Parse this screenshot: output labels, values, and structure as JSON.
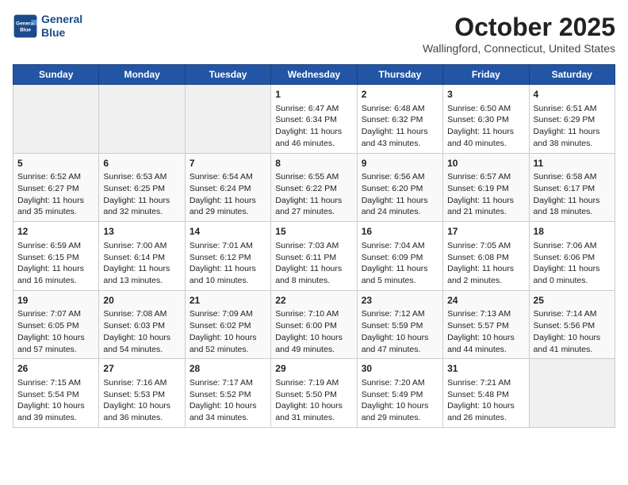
{
  "header": {
    "logo_line1": "General",
    "logo_line2": "Blue",
    "month": "October 2025",
    "location": "Wallingford, Connecticut, United States"
  },
  "weekdays": [
    "Sunday",
    "Monday",
    "Tuesday",
    "Wednesday",
    "Thursday",
    "Friday",
    "Saturday"
  ],
  "weeks": [
    [
      {
        "day": "",
        "info": ""
      },
      {
        "day": "",
        "info": ""
      },
      {
        "day": "",
        "info": ""
      },
      {
        "day": "1",
        "info": "Sunrise: 6:47 AM\nSunset: 6:34 PM\nDaylight: 11 hours\nand 46 minutes."
      },
      {
        "day": "2",
        "info": "Sunrise: 6:48 AM\nSunset: 6:32 PM\nDaylight: 11 hours\nand 43 minutes."
      },
      {
        "day": "3",
        "info": "Sunrise: 6:50 AM\nSunset: 6:30 PM\nDaylight: 11 hours\nand 40 minutes."
      },
      {
        "day": "4",
        "info": "Sunrise: 6:51 AM\nSunset: 6:29 PM\nDaylight: 11 hours\nand 38 minutes."
      }
    ],
    [
      {
        "day": "5",
        "info": "Sunrise: 6:52 AM\nSunset: 6:27 PM\nDaylight: 11 hours\nand 35 minutes."
      },
      {
        "day": "6",
        "info": "Sunrise: 6:53 AM\nSunset: 6:25 PM\nDaylight: 11 hours\nand 32 minutes."
      },
      {
        "day": "7",
        "info": "Sunrise: 6:54 AM\nSunset: 6:24 PM\nDaylight: 11 hours\nand 29 minutes."
      },
      {
        "day": "8",
        "info": "Sunrise: 6:55 AM\nSunset: 6:22 PM\nDaylight: 11 hours\nand 27 minutes."
      },
      {
        "day": "9",
        "info": "Sunrise: 6:56 AM\nSunset: 6:20 PM\nDaylight: 11 hours\nand 24 minutes."
      },
      {
        "day": "10",
        "info": "Sunrise: 6:57 AM\nSunset: 6:19 PM\nDaylight: 11 hours\nand 21 minutes."
      },
      {
        "day": "11",
        "info": "Sunrise: 6:58 AM\nSunset: 6:17 PM\nDaylight: 11 hours\nand 18 minutes."
      }
    ],
    [
      {
        "day": "12",
        "info": "Sunrise: 6:59 AM\nSunset: 6:15 PM\nDaylight: 11 hours\nand 16 minutes."
      },
      {
        "day": "13",
        "info": "Sunrise: 7:00 AM\nSunset: 6:14 PM\nDaylight: 11 hours\nand 13 minutes."
      },
      {
        "day": "14",
        "info": "Sunrise: 7:01 AM\nSunset: 6:12 PM\nDaylight: 11 hours\nand 10 minutes."
      },
      {
        "day": "15",
        "info": "Sunrise: 7:03 AM\nSunset: 6:11 PM\nDaylight: 11 hours\nand 8 minutes."
      },
      {
        "day": "16",
        "info": "Sunrise: 7:04 AM\nSunset: 6:09 PM\nDaylight: 11 hours\nand 5 minutes."
      },
      {
        "day": "17",
        "info": "Sunrise: 7:05 AM\nSunset: 6:08 PM\nDaylight: 11 hours\nand 2 minutes."
      },
      {
        "day": "18",
        "info": "Sunrise: 7:06 AM\nSunset: 6:06 PM\nDaylight: 11 hours\nand 0 minutes."
      }
    ],
    [
      {
        "day": "19",
        "info": "Sunrise: 7:07 AM\nSunset: 6:05 PM\nDaylight: 10 hours\nand 57 minutes."
      },
      {
        "day": "20",
        "info": "Sunrise: 7:08 AM\nSunset: 6:03 PM\nDaylight: 10 hours\nand 54 minutes."
      },
      {
        "day": "21",
        "info": "Sunrise: 7:09 AM\nSunset: 6:02 PM\nDaylight: 10 hours\nand 52 minutes."
      },
      {
        "day": "22",
        "info": "Sunrise: 7:10 AM\nSunset: 6:00 PM\nDaylight: 10 hours\nand 49 minutes."
      },
      {
        "day": "23",
        "info": "Sunrise: 7:12 AM\nSunset: 5:59 PM\nDaylight: 10 hours\nand 47 minutes."
      },
      {
        "day": "24",
        "info": "Sunrise: 7:13 AM\nSunset: 5:57 PM\nDaylight: 10 hours\nand 44 minutes."
      },
      {
        "day": "25",
        "info": "Sunrise: 7:14 AM\nSunset: 5:56 PM\nDaylight: 10 hours\nand 41 minutes."
      }
    ],
    [
      {
        "day": "26",
        "info": "Sunrise: 7:15 AM\nSunset: 5:54 PM\nDaylight: 10 hours\nand 39 minutes."
      },
      {
        "day": "27",
        "info": "Sunrise: 7:16 AM\nSunset: 5:53 PM\nDaylight: 10 hours\nand 36 minutes."
      },
      {
        "day": "28",
        "info": "Sunrise: 7:17 AM\nSunset: 5:52 PM\nDaylight: 10 hours\nand 34 minutes."
      },
      {
        "day": "29",
        "info": "Sunrise: 7:19 AM\nSunset: 5:50 PM\nDaylight: 10 hours\nand 31 minutes."
      },
      {
        "day": "30",
        "info": "Sunrise: 7:20 AM\nSunset: 5:49 PM\nDaylight: 10 hours\nand 29 minutes."
      },
      {
        "day": "31",
        "info": "Sunrise: 7:21 AM\nSunset: 5:48 PM\nDaylight: 10 hours\nand 26 minutes."
      },
      {
        "day": "",
        "info": ""
      }
    ]
  ]
}
